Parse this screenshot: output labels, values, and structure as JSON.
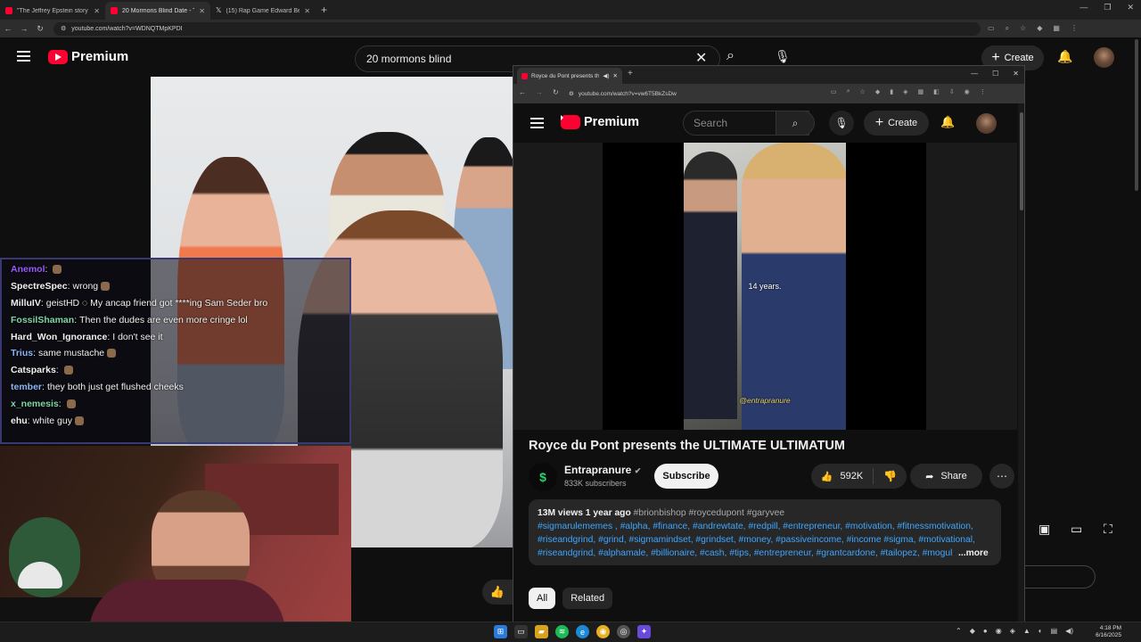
{
  "browser": {
    "tabs": [
      {
        "title": "\"The Jeffrey Epstein story is a b"
      },
      {
        "title": "20 Mormons Blind Date - The..."
      },
      {
        "title": "(15) Rap Game Edward Bernays"
      }
    ],
    "new_tab": "+",
    "url": "youtube.com/watch?v=WDNQTMpKPDI"
  },
  "yt_outer": {
    "logo": "Premium",
    "search_value": "20 mormons blind",
    "create_label": "Create"
  },
  "chat": [
    {
      "user": "Anemol",
      "color": "#9b59ff",
      "msg": ""
    },
    {
      "user": "SpectreSpec",
      "color": "#f1f1f1",
      "msg": "wrong"
    },
    {
      "user": "MilluIV",
      "color": "#f1f1f1",
      "msg": "geistHD ◌ My ancap friend got ****ing Sam Seder bro"
    },
    {
      "user": "FossilShaman",
      "color": "#7fd6a4",
      "msg": "Then the dudes are even more cringe lol"
    },
    {
      "user": "Hard_Won_Ignorance",
      "color": "#f1f1f1",
      "msg": "I don't see it"
    },
    {
      "user": "Trius",
      "color": "#8ab4f8",
      "msg": "same mustache"
    },
    {
      "user": "Catsparks",
      "color": "#f1f1f1",
      "msg": ""
    },
    {
      "user": "tember",
      "color": "#8ab4f8",
      "msg": "they both just get flushed cheeks"
    },
    {
      "user": "x_nemesis",
      "color": "#7fd6a4",
      "msg": ""
    },
    {
      "user": "ehu",
      "color": "#f1f1f1",
      "msg": "white guy"
    }
  ],
  "popup": {
    "tab_title": "Royce du Pont presents the...",
    "url": "youtube.com/watch?v=vw6T5BkZsDw",
    "logo": "Premium",
    "search_placeholder": "Search",
    "create_label": "Create",
    "caption_mid": "14 years.",
    "caption_bottom": "@entrapranure",
    "title": "Royce du Pont presents the ULTIMATE ULTIMATUM",
    "channel": "Entrapranure",
    "subscribers": "833K subscribers",
    "subscribe_label": "Subscribe",
    "likes": "592K",
    "share_label": "Share",
    "desc_meta": "13M views  1 year ago",
    "desc_tags_line1": "#brionbishop #roycedupont #garyvee",
    "desc_line2": "#sigmarulememes , #alpha, #finance, #andrewtate, #redpill, #entrepreneur, #motivation, #fitnessmotivation,",
    "desc_line3": "#riseandgrind, #grind, #sigmamindset, #grindset, #money, #passiveincome, #income #sigma, #motivational,",
    "desc_line4": "#riseandgrind, #alphamale, #billionaire, #cash, #tips, #entrepreneur, #grantcardone, #tailopez, #mogul",
    "more_label": "...more",
    "chips": [
      {
        "label": "All"
      },
      {
        "label": "Related"
      }
    ]
  },
  "taskbar": {
    "time": "4:18 PM",
    "date": "6/16/2025"
  },
  "colors": {
    "youtube_red": "#ff0033",
    "link_blue": "#3ea6ff",
    "chat_border": "#3a3870"
  }
}
